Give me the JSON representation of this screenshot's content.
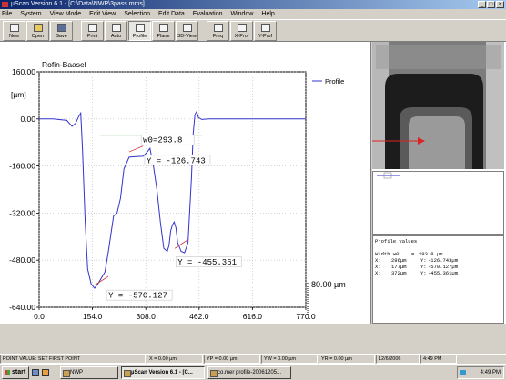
{
  "window": {
    "title": "µScan Version 6.1 - [C:\\Data\\NWP\\3pass.mms]",
    "minimize": "_",
    "maximize": "□",
    "close": "×"
  },
  "menu": [
    "File",
    "System",
    "View Mode",
    "Edit View",
    "Selection",
    "Edit Data",
    "Evaluation",
    "Window",
    "Help"
  ],
  "toolbar": {
    "new": "New",
    "open": "Open",
    "save": "Save",
    "print": "Print",
    "auto": "Auto",
    "profile": "Profile",
    "plane": "Plane",
    "view3d": "3D-View",
    "freq": "Freq",
    "xprof": "X-Prof",
    "yprof": "Y-Prof"
  },
  "chart_data": {
    "type": "line",
    "title": "Rofin-Baasel",
    "ylabel": "[µm]",
    "xlabel": "[µm]",
    "xlim": [
      0,
      770
    ],
    "ylim": [
      -640,
      160
    ],
    "x_ticks": [
      "0.0",
      "154.0",
      "308.0",
      "462.0",
      "616.0",
      "770.0"
    ],
    "y_ticks": [
      "160.00",
      "0.00",
      "-160.00",
      "-320.00",
      "-480.00",
      "-640.00"
    ],
    "series": [
      {
        "name": "Profile",
        "color": "#3333cc",
        "x": [
          0,
          40,
          80,
          95,
          105,
          115,
          120,
          125,
          133,
          140,
          150,
          160,
          170,
          180,
          190,
          200,
          215,
          225,
          235,
          245,
          260,
          280,
          300,
          310,
          320,
          330,
          340,
          350,
          360,
          370,
          375,
          380,
          385,
          390,
          395,
          400,
          410,
          420,
          430,
          440,
          445,
          450,
          455,
          460,
          470,
          490,
          520,
          540,
          560,
          600,
          640,
          700,
          770
        ],
        "y": [
          0,
          0,
          -5,
          -25,
          -15,
          10,
          20,
          -100,
          -350,
          -510,
          -560,
          -575,
          -560,
          -540,
          -520,
          -450,
          -330,
          -320,
          -270,
          -170,
          -130,
          -128,
          -127,
          -115,
          -100,
          -160,
          -240,
          -350,
          -440,
          -450,
          -430,
          -380,
          -360,
          -350,
          -370,
          -420,
          -450,
          -455,
          -420,
          -200,
          -50,
          15,
          25,
          5,
          -2,
          0,
          0,
          0,
          0,
          0,
          0,
          0,
          0
        ]
      }
    ],
    "annotations": [
      "w0=293.8",
      "Y = -126.743",
      "Y = -455.361",
      "Y = -570.127"
    ],
    "side_label": "80.00 µm",
    "grid": true,
    "legend": "top-right"
  },
  "pv": {
    "title": "Profile values",
    "rows": [
      [
        "Width w0",
        "=",
        "",
        "293.8 µm"
      ],
      [
        "X:",
        "296µm",
        "Y:",
        "-126.743µm"
      ],
      [
        "X:",
        "177µm",
        "Y:",
        "-570.127µm"
      ],
      [
        "X:",
        "372µm",
        "Y:",
        "-455.361µm"
      ]
    ]
  },
  "status": [
    "POINT VALUE: SET FIRST POINT",
    "X = 0.00 µm",
    "YP = 0.00 µm",
    "YW = 0.00 µm",
    "YR = 0.00 µm",
    "12/6/2006",
    "4:49 PM"
  ],
  "taskbar": {
    "start": "start",
    "tasks": [
      "NWP",
      "µScan Version 6.1 - [C...",
      "co.mer profile-20061205..."
    ],
    "clock": "4:49 PM"
  },
  "colors": {
    "profile": "#3333cc",
    "w0_line": "#339933",
    "marker": "#cc3333"
  }
}
